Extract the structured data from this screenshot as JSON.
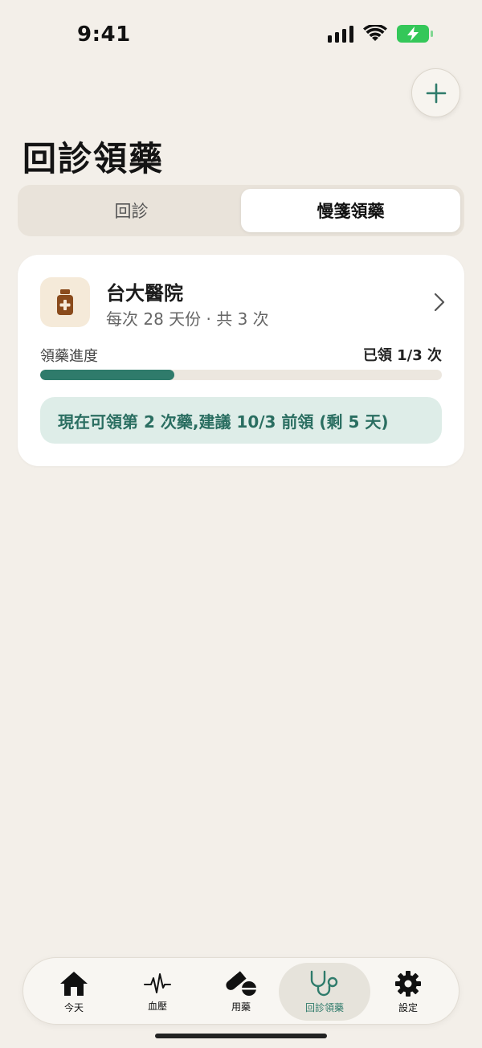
{
  "status_bar": {
    "time": "9:41"
  },
  "header": {
    "title": "回診領藥",
    "add_icon": "plus-icon"
  },
  "segmented": {
    "tabs": [
      {
        "label": "回診",
        "active": false
      },
      {
        "label": "慢箋領藥",
        "active": true
      }
    ]
  },
  "card": {
    "hospital": "台大醫院",
    "schedule": "每次 28 天份 · 共 3 次",
    "progress_label": "領藥進度",
    "progress_count": "已領 1/3 次",
    "progress_fraction": 0.3333,
    "notice": "現在可領第 2 次藥,建議 10/3 前領 (剩 5 天)",
    "icon": "medicine-bottle-icon"
  },
  "tab_bar": {
    "items": [
      {
        "label": "今天",
        "icon": "home-icon"
      },
      {
        "label": "血壓",
        "icon": "pulse-icon"
      },
      {
        "label": "用藥",
        "icon": "pills-icon"
      },
      {
        "label": "回診領藥",
        "icon": "stethoscope-icon",
        "active": true
      },
      {
        "label": "設定",
        "icon": "gear-icon"
      }
    ]
  },
  "colors": {
    "accent": "#2F7B6B",
    "background": "#F3EFE9",
    "notice_bg": "#DEEDE8",
    "icon_bg": "#F5EAD9",
    "icon_fg": "#8A4B1C"
  }
}
